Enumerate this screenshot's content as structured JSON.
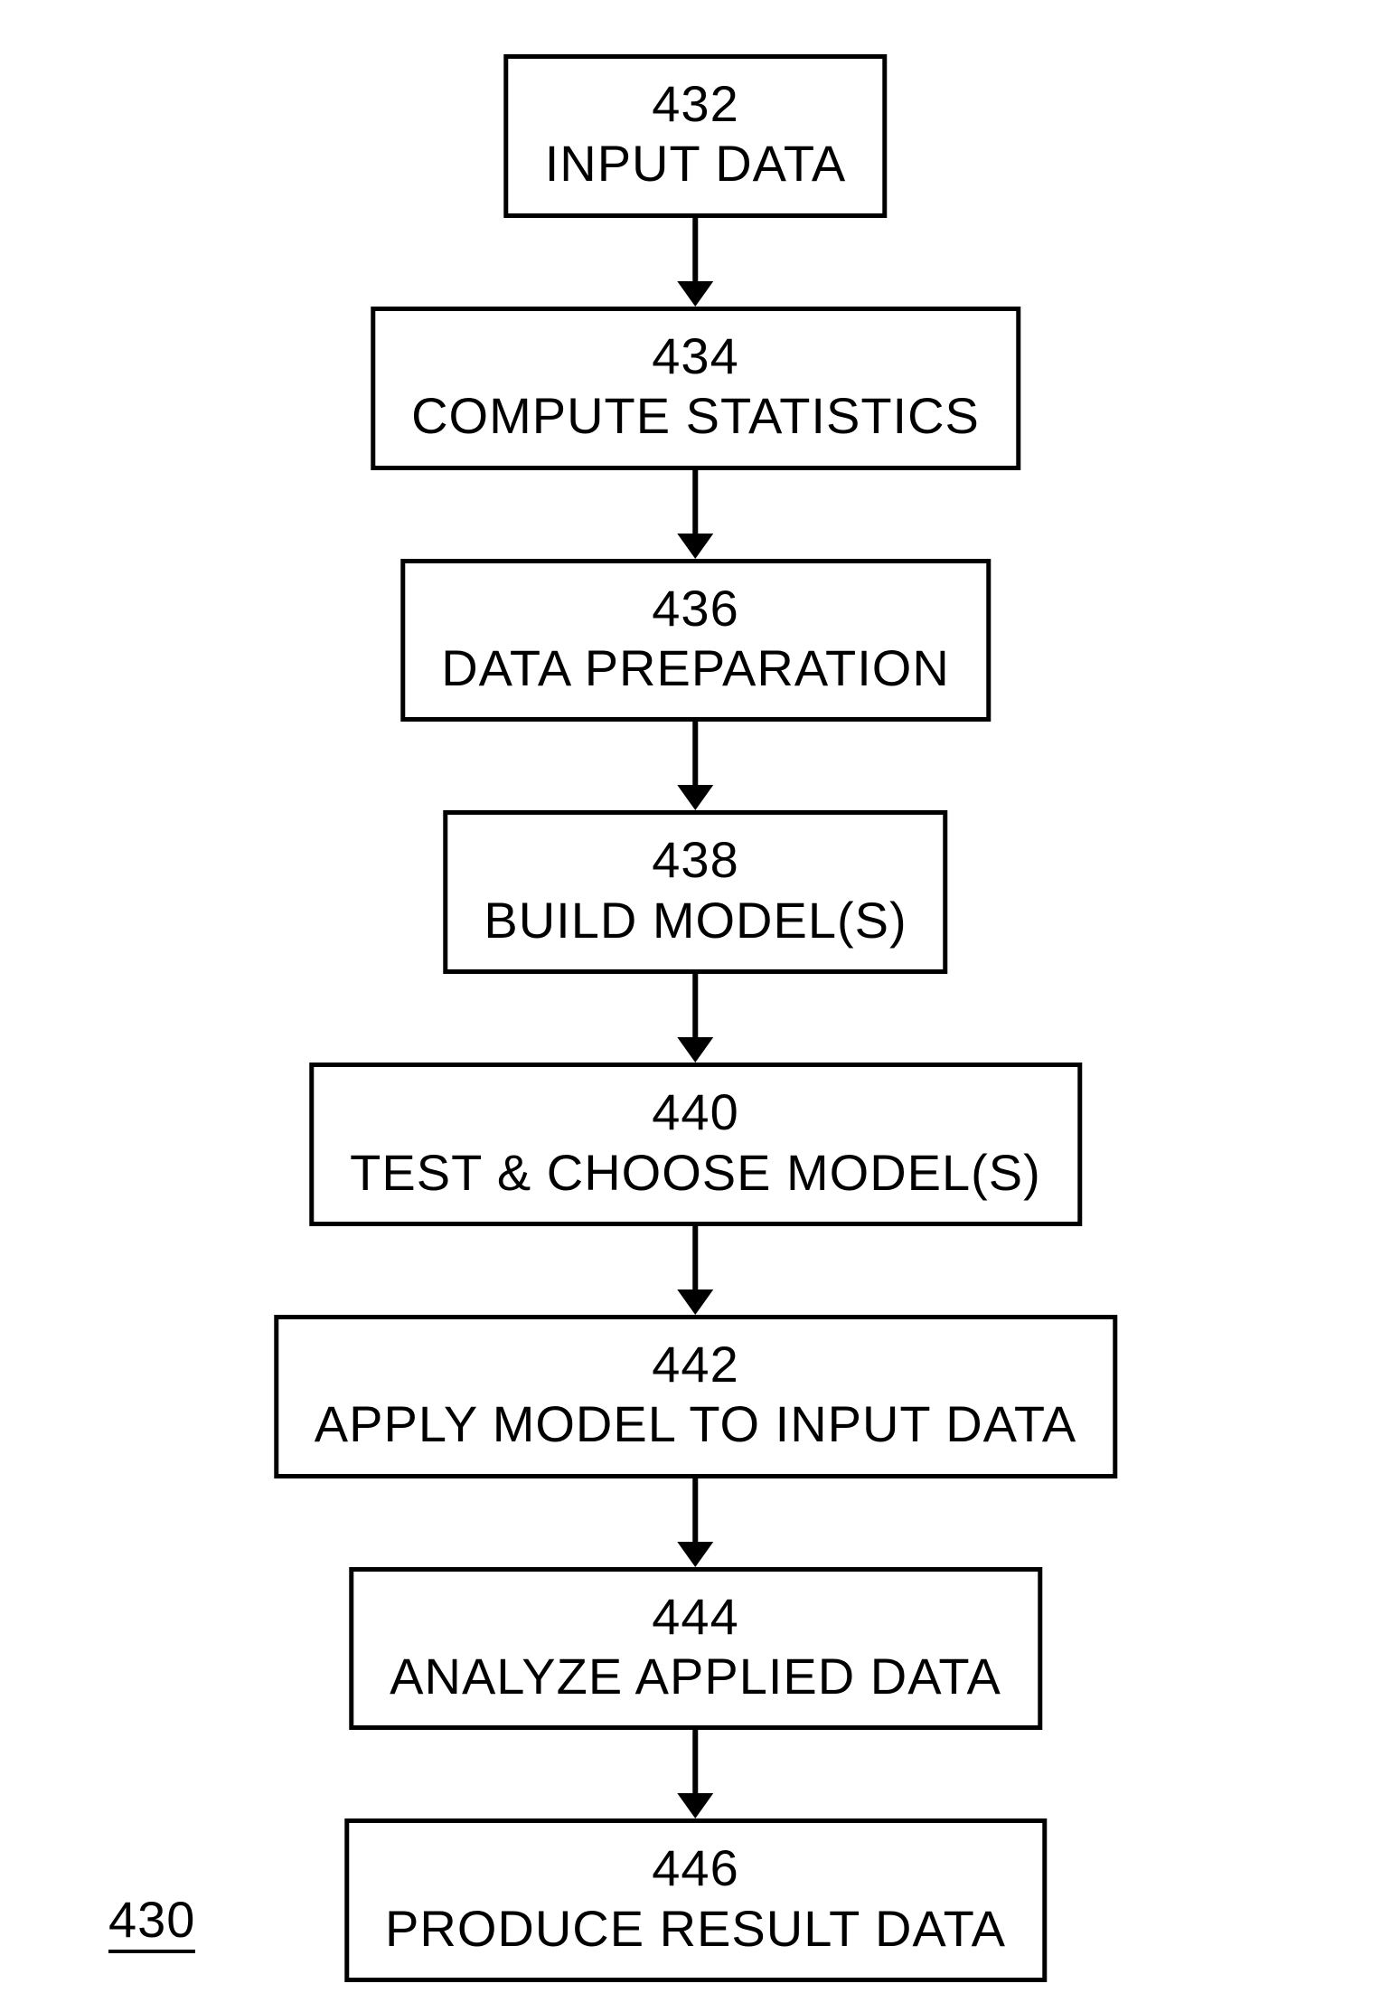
{
  "figure_ref": "430",
  "steps": [
    {
      "num": "432",
      "label": "INPUT DATA"
    },
    {
      "num": "434",
      "label": "COMPUTE STATISTICS"
    },
    {
      "num": "436",
      "label": "DATA PREPARATION"
    },
    {
      "num": "438",
      "label": "BUILD MODEL(S)"
    },
    {
      "num": "440",
      "label": "TEST & CHOOSE MODEL(S)"
    },
    {
      "num": "442",
      "label": "APPLY MODEL TO INPUT DATA"
    },
    {
      "num": "444",
      "label": "ANALYZE APPLIED DATA"
    },
    {
      "num": "446",
      "label": "PRODUCE RESULT DATA"
    }
  ],
  "chart_data": {
    "type": "flowchart",
    "direction": "top-to-bottom",
    "nodes": [
      {
        "id": "432",
        "label": "INPUT DATA"
      },
      {
        "id": "434",
        "label": "COMPUTE STATISTICS"
      },
      {
        "id": "436",
        "label": "DATA PREPARATION"
      },
      {
        "id": "438",
        "label": "BUILD MODEL(S)"
      },
      {
        "id": "440",
        "label": "TEST & CHOOSE MODEL(S)"
      },
      {
        "id": "442",
        "label": "APPLY MODEL TO INPUT DATA"
      },
      {
        "id": "444",
        "label": "ANALYZE APPLIED DATA"
      },
      {
        "id": "446",
        "label": "PRODUCE RESULT DATA"
      }
    ],
    "edges": [
      {
        "from": "432",
        "to": "434"
      },
      {
        "from": "434",
        "to": "436"
      },
      {
        "from": "436",
        "to": "438"
      },
      {
        "from": "438",
        "to": "440"
      },
      {
        "from": "440",
        "to": "442"
      },
      {
        "from": "442",
        "to": "444"
      },
      {
        "from": "444",
        "to": "446"
      }
    ],
    "figure_number": "430"
  }
}
